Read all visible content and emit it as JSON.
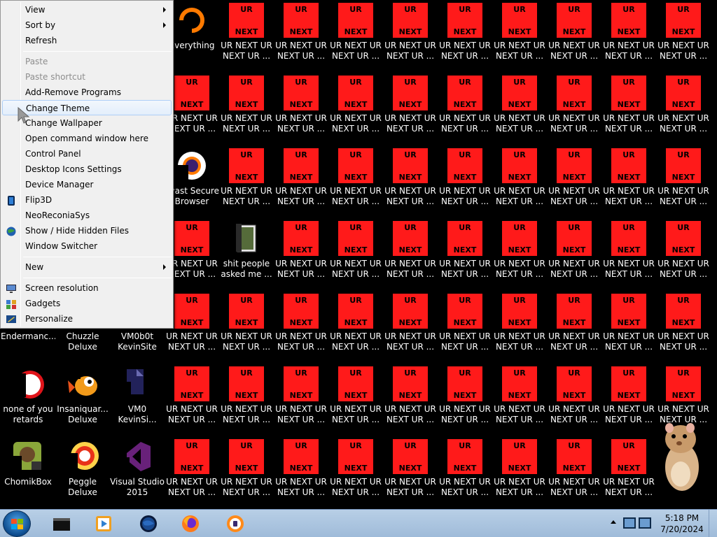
{
  "context_menu": {
    "items": [
      {
        "label": "View",
        "submenu": true
      },
      {
        "label": "Sort by",
        "submenu": true
      },
      {
        "label": "Refresh"
      },
      {
        "label": "Paste",
        "disabled": true
      },
      {
        "label": "Paste shortcut",
        "disabled": true
      },
      {
        "label": "Add-Remove Programs"
      },
      {
        "label": "Change Theme",
        "highlighted": true
      },
      {
        "label": "Change Wallpaper"
      },
      {
        "label": "Open command window here"
      },
      {
        "label": "Control Panel"
      },
      {
        "label": "Desktop Icons Settings"
      },
      {
        "label": "Device Manager"
      },
      {
        "label": "Flip3D",
        "icon": "flip3d-icon"
      },
      {
        "label": "NeoReconiaSys"
      },
      {
        "label": "Show / Hide Hidden Files",
        "icon": "globe-icon"
      },
      {
        "label": "Window Switcher"
      },
      {
        "label": "New",
        "submenu": true
      },
      {
        "label": "Screen resolution",
        "icon": "monitor-icon"
      },
      {
        "label": "Gadgets",
        "icon": "gadgets-icon"
      },
      {
        "label": "Personalize",
        "icon": "personalize-icon"
      }
    ]
  },
  "desktop": {
    "tile_text": {
      "top": "UR",
      "bottom": "NEXT"
    },
    "ur_label": "UR NEXT UR NEXT UR ...",
    "named_icons": [
      {
        "label": "Everything",
        "icon": "everything-icon"
      },
      {
        "label": "Avast Secure Browser",
        "icon": "avast-icon"
      },
      {
        "label": "shit people asked me ...",
        "icon": "folder-icon"
      },
      {
        "label": "Endermanc...",
        "icon": "generic-icon"
      },
      {
        "label": "Chuzzle Deluxe",
        "icon": "generic-icon"
      },
      {
        "label": "VM0b0t KevinSite",
        "icon": "generic-icon"
      },
      {
        "label": "none of you retards kno...",
        "icon": "red-circle-icon"
      },
      {
        "label": "Insaniquar... Deluxe",
        "icon": "fish-icon"
      },
      {
        "label": "VM0 KevinSi...",
        "icon": "document-icon"
      },
      {
        "label": "ChomikBox",
        "icon": "chomikbox-icon"
      },
      {
        "label": "Peggle Deluxe",
        "icon": "peggle-icon"
      },
      {
        "label": "Visual Studio 2015",
        "icon": "visual-studio-icon"
      }
    ],
    "mascot": "hamster-icon"
  },
  "taskbar": {
    "apps": [
      "terminal-icon",
      "media-player-icon",
      "avast-globe-icon",
      "firefox-icon",
      "avast-browser-icon"
    ],
    "clock_time": "5:18 PM",
    "clock_date": "7/20/2024"
  },
  "colors": {
    "tile_red": "#ff1a1a",
    "menu_bg": "#f0f0f0",
    "taskbar": "#a9c4df"
  }
}
